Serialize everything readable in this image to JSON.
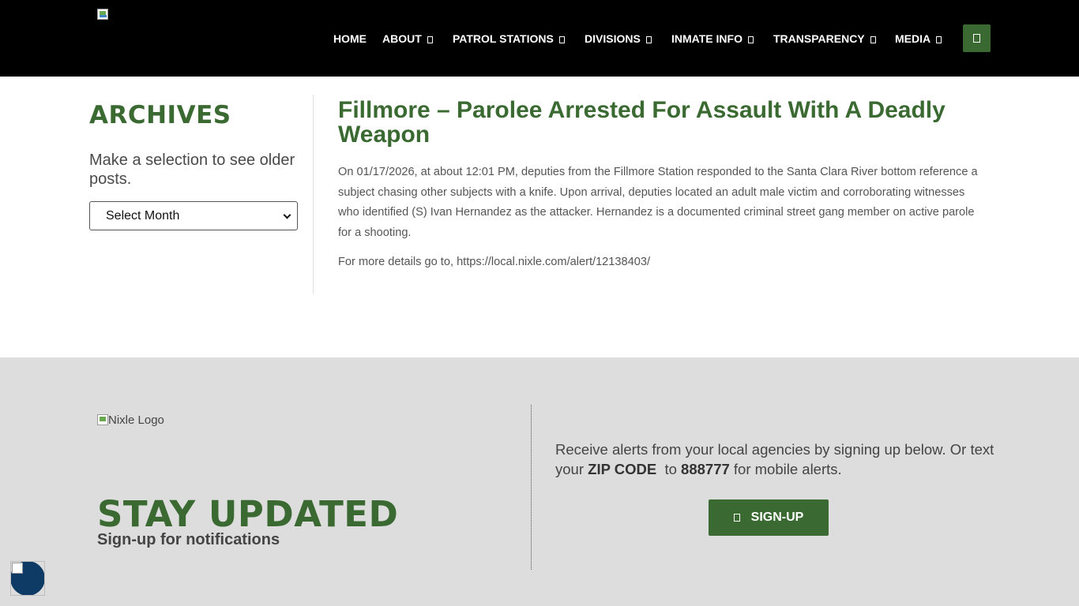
{
  "header": {
    "nav": [
      {
        "label": "HOME",
        "has_dropdown": false
      },
      {
        "label": "ABOUT",
        "has_dropdown": true
      },
      {
        "label": "PATROL STATIONS",
        "has_dropdown": true
      },
      {
        "label": "DIVISIONS",
        "has_dropdown": true
      },
      {
        "label": "INMATE INFO",
        "has_dropdown": true
      },
      {
        "label": "TRANSPARENCY",
        "has_dropdown": true
      },
      {
        "label": "MEDIA",
        "has_dropdown": true
      }
    ],
    "search_icon": "search-icon"
  },
  "sidebar": {
    "title": "ARCHIVES",
    "description": "Make a selection to see older posts.",
    "select_value": "Select Month"
  },
  "article": {
    "title": "Fillmore – Parolee Arrested For Assault With A Deadly Weapon",
    "body": "On 01/17/2026, at about 12:01 PM, deputies from the Fillmore Station responded to the Santa Clara River bottom reference a subject chasing other subjects with a knife.  Upon arrival, deputies located an adult male victim and corroborating witnesses who identified (S) Ivan Hernandez as the attacker.  Hernandez is a documented criminal street gang member on active parole for a shooting.",
    "link_prefix": "For more details go to, ",
    "link_url": "https://local.nixle.com/alert/12138403/"
  },
  "footer": {
    "logo_alt": "Nixle Logo",
    "stay_title": "STAY UPDATED",
    "stay_subtitle": "Sign-up for notifications",
    "alerts_text_1": "Receive alerts from your local agencies by signing up below. Or text your ",
    "alerts_zip": "ZIP CODE",
    "alerts_text_2": "  to ",
    "alerts_number": "888777",
    "alerts_text_3": " for mobile alerts.",
    "signup_label": "SIGN-UP"
  },
  "colors": {
    "brand_green": "#3a6a32",
    "header_bg": "#000000",
    "footer_bg": "#dddddd",
    "widget_blue": "#0d3b66"
  }
}
